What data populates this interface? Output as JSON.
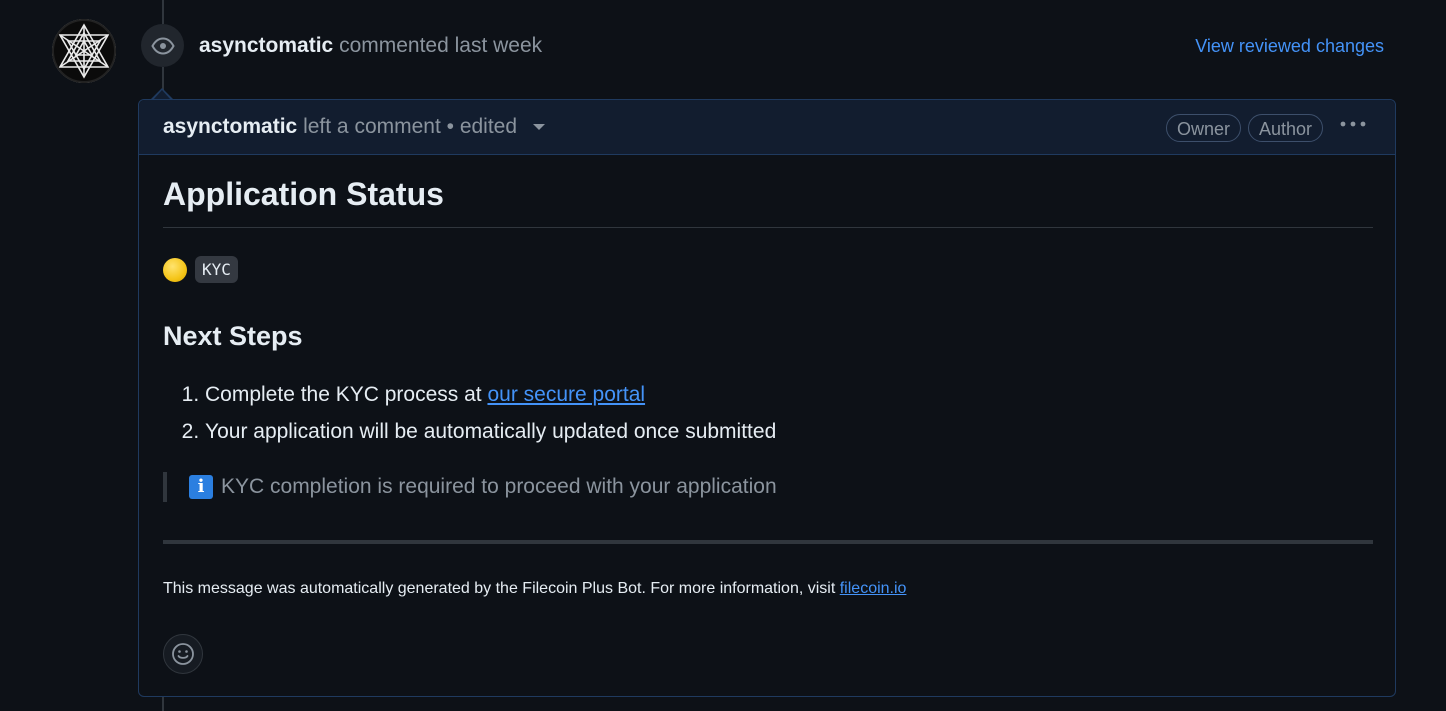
{
  "timeline": {
    "author": "asynctomatic",
    "action": "commented last week",
    "view_changes": "View reviewed changes"
  },
  "comment": {
    "author": "asynctomatic",
    "action": "left a comment • edited",
    "labels": [
      "Owner",
      "Author"
    ],
    "heading": "Application Status",
    "status_code": "KYC",
    "next_heading": "Next Steps",
    "steps": [
      {
        "prefix": "Complete the KYC process at ",
        "link": "our secure portal"
      },
      {
        "text": "Your application will be automatically updated once submitted"
      }
    ],
    "quote_text": "KYC completion is required to proceed with your application",
    "footer_text": "This message was automatically generated by the Filecoin Plus Bot. For more information, visit ",
    "footer_link": "filecoin.io"
  },
  "icons": {
    "eye": "eye-icon",
    "kebab": "kebab-horizontal-icon",
    "info": "information-icon",
    "status_dot": "yellow-circle-emoji",
    "smiley": "smiley-icon",
    "caret": "triangle-down-icon"
  },
  "colors": {
    "background": "#0d1117",
    "accent": "#4493f8",
    "muted": "#8b949e",
    "header_bg": "#121d2f",
    "border": "#1f3a5f",
    "status_yellow": "#f5c518"
  }
}
